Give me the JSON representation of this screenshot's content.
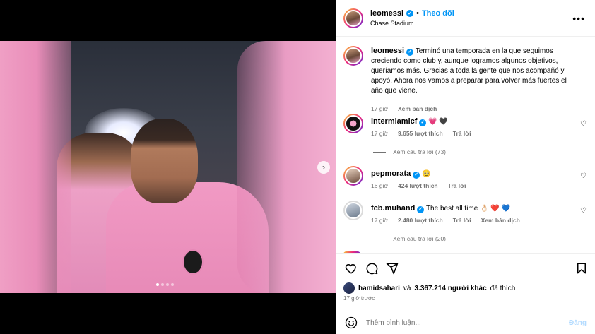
{
  "post": {
    "author": "leomessi",
    "follow_label": "Theo dõi",
    "separator": "•",
    "location": "Chase Stadium",
    "more_label": "•••"
  },
  "caption": {
    "username": "leomessi",
    "text": "Terminó una temporada en la que seguimos creciendo como club y, aunque logramos algunos objetivos, queríamos más. Gracias a toda la gente que nos acompañó y apoyó. Ahora nos vamos a preparar para volver más fuertes el año que viene.",
    "time": "17 giờ",
    "translate": "Xem bản dịch"
  },
  "comments": [
    {
      "username": "intermiamicf",
      "text": "💗 🖤",
      "time": "17 giờ",
      "likes": "9.655 lượt thích",
      "reply": "Trả lời",
      "view_replies": "Xem câu trả lời (73)"
    },
    {
      "username": "pepmorata",
      "text": "🥹",
      "time": "16 giờ",
      "likes": "424 lượt thích",
      "reply": "Trả lời"
    },
    {
      "username": "fcb.muhand",
      "text": "The best all time 👌🏻 ❤️ 💙",
      "time": "17 giờ",
      "likes": "2.480 lượt thích",
      "reply": "Trả lời",
      "translate": "Xem bản dịch",
      "view_replies": "Xem câu trả lời (20)"
    }
  ],
  "likes_summary": {
    "user": "hamidsahari",
    "and": "và",
    "others": "3.367.214 người khác",
    "suffix": "đã thích"
  },
  "posted_ago": "17 giờ trước",
  "add_comment": {
    "placeholder": "Thêm bình luận...",
    "post_label": "Đăng"
  },
  "carousel": {
    "total_slides": 4,
    "active_slide": 1,
    "next_icon": "›"
  },
  "colors": {
    "accent": "#0095f6",
    "muted": "#737373",
    "jersey_pink": "#f19ac4"
  }
}
